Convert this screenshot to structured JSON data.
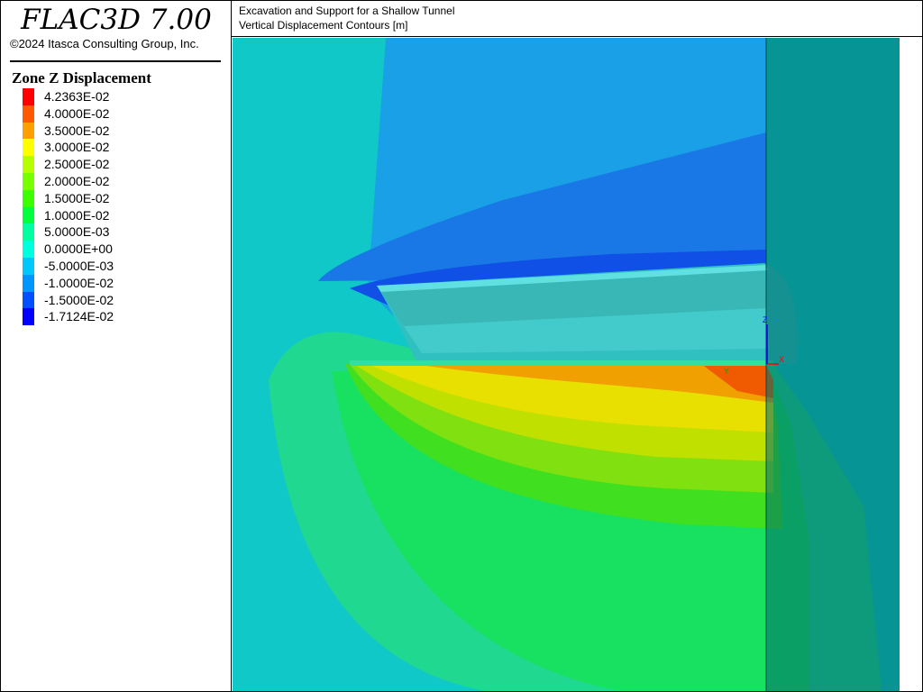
{
  "app": {
    "title": "FLAC3D 7.00",
    "copyright": "©2024 Itasca Consulting Group, Inc."
  },
  "plot": {
    "title_line1": "Excavation and Support for a Shallow Tunnel",
    "title_line2": "Vertical Displacement Contours [m]"
  },
  "legend": {
    "title": "Zone Z Displacement",
    "items": [
      {
        "label": "4.2363E-02",
        "color": "#ff0000"
      },
      {
        "label": "4.0000E-02",
        "color": "#ff5a00"
      },
      {
        "label": "3.5000E-02",
        "color": "#ffa000"
      },
      {
        "label": "3.0000E-02",
        "color": "#ffff00"
      },
      {
        "label": "2.5000E-02",
        "color": "#b4ff00"
      },
      {
        "label": "2.0000E-02",
        "color": "#78ff00"
      },
      {
        "label": "1.5000E-02",
        "color": "#3cff00"
      },
      {
        "label": "1.0000E-02",
        "color": "#00ff3c"
      },
      {
        "label": "5.0000E-03",
        "color": "#00ffa0"
      },
      {
        "label": "0.0000E+00",
        "color": "#00ffdc"
      },
      {
        "label": "-5.0000E-03",
        "color": "#00c8ff"
      },
      {
        "label": "-1.0000E-02",
        "color": "#0096ff"
      },
      {
        "label": "-1.5000E-02",
        "color": "#0050ff"
      },
      {
        "label": "-1.7124E-02",
        "color": "#0000ff"
      }
    ]
  },
  "axes": {
    "z_label": "Z",
    "x_label": "X",
    "y_label": "Y",
    "z_color": "#0000ff",
    "x_color": "#ff0000",
    "y_color": "#00aa00"
  }
}
